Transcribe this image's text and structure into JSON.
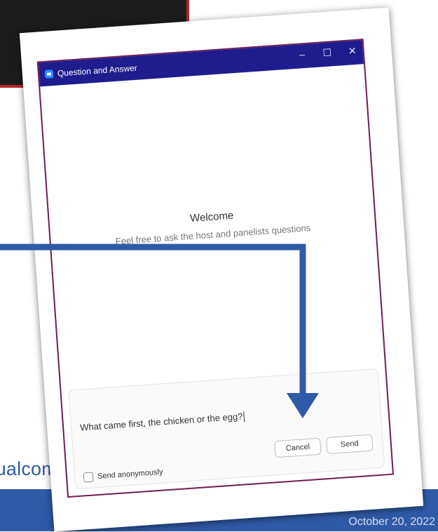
{
  "window": {
    "title": "Question and Answer",
    "minimize_glyph": "–",
    "maximize_glyph": "☐",
    "close_glyph": "✕"
  },
  "welcome": {
    "title": "Welcome",
    "subtitle": "Feel free to ask the host and panelists questions"
  },
  "composer": {
    "question": "What came first, the chicken or the egg?",
    "anonymous_label": "Send anonymously",
    "anonymous_checked": false,
    "cancel_label": "Cancel",
    "send_label": "Send"
  },
  "slide": {
    "url_fragment": "tualcommunitymeetings",
    "date": "October 20, 2022"
  },
  "colors": {
    "titlebar": "#1f1c8e",
    "window_border": "#6d1e54",
    "accent_blue": "#2f5aa6",
    "accent_red": "#b3262c"
  }
}
